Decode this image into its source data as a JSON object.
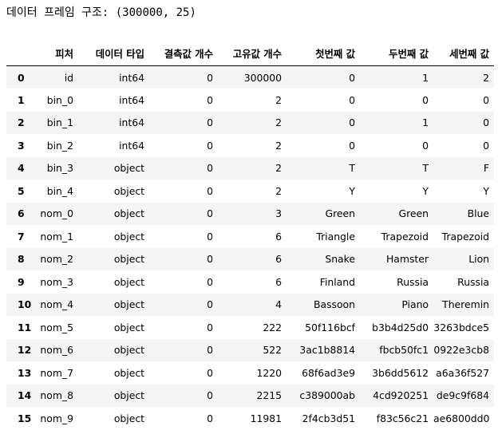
{
  "output": {
    "shape_text": "데이터 프레임 구조: (300000, 25)"
  },
  "table": {
    "columns": [
      "",
      "피처",
      "데이터 타입",
      "결측값 개수",
      "고유값 개수",
      "첫번째 값",
      "두번째 값",
      "세번째 값"
    ],
    "rows": [
      [
        "0",
        "id",
        "int64",
        "0",
        "300000",
        "0",
        "1",
        "2"
      ],
      [
        "1",
        "bin_0",
        "int64",
        "0",
        "2",
        "0",
        "0",
        "0"
      ],
      [
        "2",
        "bin_1",
        "int64",
        "0",
        "2",
        "0",
        "1",
        "0"
      ],
      [
        "3",
        "bin_2",
        "int64",
        "0",
        "2",
        "0",
        "0",
        "0"
      ],
      [
        "4",
        "bin_3",
        "object",
        "0",
        "2",
        "T",
        "T",
        "F"
      ],
      [
        "5",
        "bin_4",
        "object",
        "0",
        "2",
        "Y",
        "Y",
        "Y"
      ],
      [
        "6",
        "nom_0",
        "object",
        "0",
        "3",
        "Green",
        "Green",
        "Blue"
      ],
      [
        "7",
        "nom_1",
        "object",
        "0",
        "6",
        "Triangle",
        "Trapezoid",
        "Trapezoid"
      ],
      [
        "8",
        "nom_2",
        "object",
        "0",
        "6",
        "Snake",
        "Hamster",
        "Lion"
      ],
      [
        "9",
        "nom_3",
        "object",
        "0",
        "6",
        "Finland",
        "Russia",
        "Russia"
      ],
      [
        "10",
        "nom_4",
        "object",
        "0",
        "4",
        "Bassoon",
        "Piano",
        "Theremin"
      ],
      [
        "11",
        "nom_5",
        "object",
        "0",
        "222",
        "50f116bcf",
        "b3b4d25d0",
        "3263bdce5"
      ],
      [
        "12",
        "nom_6",
        "object",
        "0",
        "522",
        "3ac1b8814",
        "fbcb50fc1",
        "0922e3cb8"
      ],
      [
        "13",
        "nom_7",
        "object",
        "0",
        "1220",
        "68f6ad3e9",
        "3b6dd5612",
        "a6a36f527"
      ],
      [
        "14",
        "nom_8",
        "object",
        "0",
        "2215",
        "c389000ab",
        "4cd920251",
        "de9c9f684"
      ],
      [
        "15",
        "nom_9",
        "object",
        "0",
        "11981",
        "2f4cb3d51",
        "f83c56c21",
        "ae6800dd0"
      ]
    ]
  },
  "colors": {
    "stripe": "#f5f5f5",
    "background": "#ffffff",
    "header_rule": "#000000"
  }
}
